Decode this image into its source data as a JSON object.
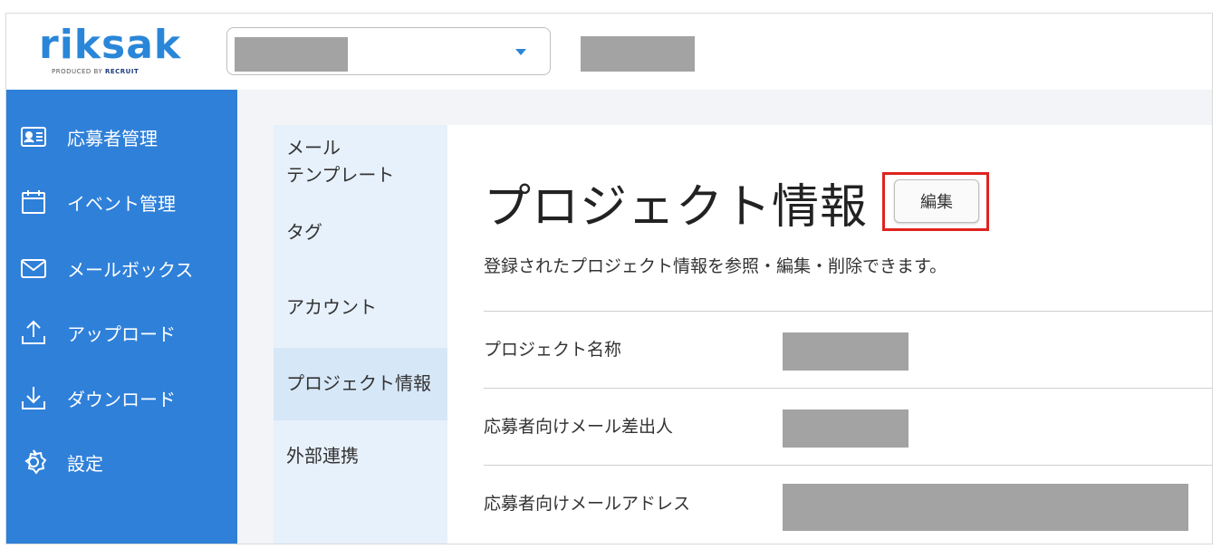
{
  "header": {
    "logo_text": "riksak",
    "logo_sub_prefix": "PRODUCED BY",
    "logo_sub_brand": "RECRUIT",
    "project_select_value": "",
    "header_info": ""
  },
  "sidebar": {
    "items": [
      {
        "label": "応募者管理",
        "icon": "id-card-icon"
      },
      {
        "label": "イベント管理",
        "icon": "calendar-icon"
      },
      {
        "label": "メールボックス",
        "icon": "mail-icon"
      },
      {
        "label": "アップロード",
        "icon": "upload-icon"
      },
      {
        "label": "ダウンロード",
        "icon": "download-icon"
      },
      {
        "label": "設定",
        "icon": "gear-icon"
      }
    ]
  },
  "subnav": {
    "items": [
      {
        "label_line1": "メール",
        "label_line2": "テンプレート"
      },
      {
        "label_line1": "タグ"
      },
      {
        "label_line1": "アカウント"
      },
      {
        "label_line1": "プロジェクト情報",
        "active": true
      },
      {
        "label_line1": "外部連携"
      }
    ]
  },
  "main": {
    "title": "プロジェクト情報",
    "edit_label": "編集",
    "description": "登録されたプロジェクト情報を参照・編集・削除できます。",
    "rows": [
      {
        "label": "プロジェクト名称",
        "value": ""
      },
      {
        "label": "応募者向けメール差出人",
        "value": ""
      },
      {
        "label": "応募者向けメールアドレス",
        "value": ""
      }
    ]
  },
  "colors": {
    "brand": "#2a86d8",
    "sidebar": "#2f80d9",
    "highlight": "#e0231d",
    "redaction": "#a3a3a3"
  }
}
